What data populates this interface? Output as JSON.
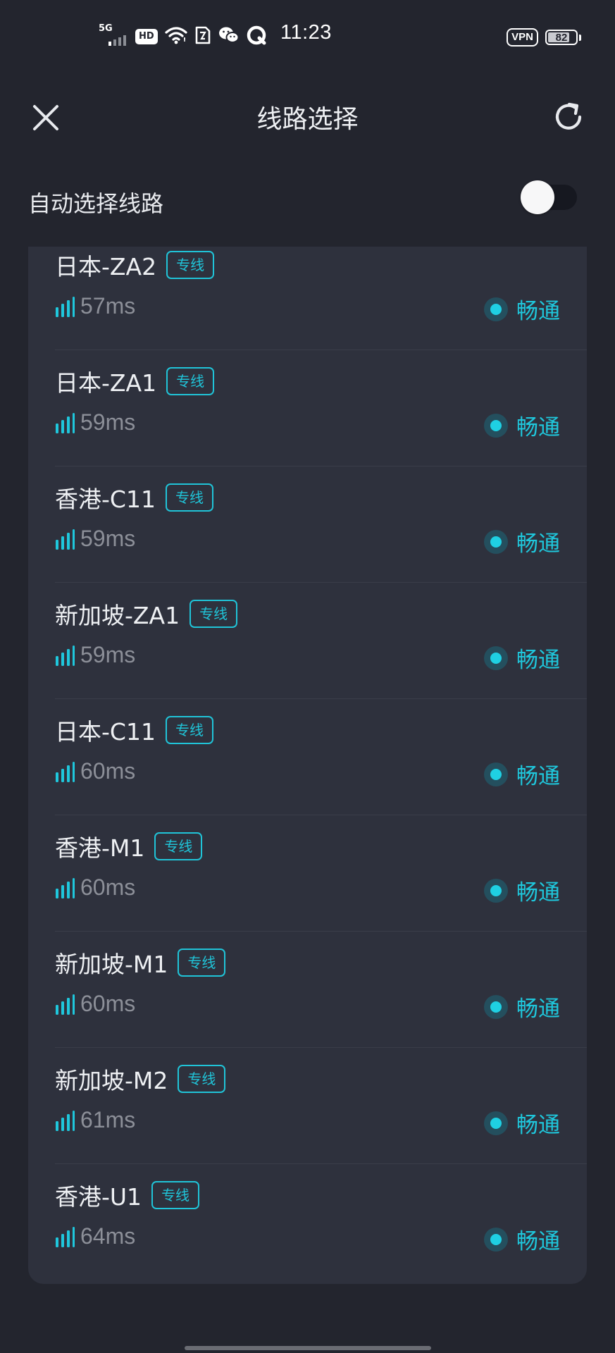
{
  "status_bar": {
    "network": "5G",
    "hd": "HD",
    "time": "11:23",
    "vpn": "VPN",
    "battery": "82",
    "battery_level": 0.82
  },
  "header": {
    "title": "线路选择"
  },
  "auto_select": {
    "label": "自动选择线路",
    "enabled": false
  },
  "colors": {
    "accent": "#1fc7dc",
    "background": "#23252e",
    "card": "#2e313d"
  },
  "servers": [
    {
      "name": "日本-ZA2",
      "tag": "专线",
      "latency": "57ms",
      "status": "畅通"
    },
    {
      "name": "日本-ZA1",
      "tag": "专线",
      "latency": "59ms",
      "status": "畅通"
    },
    {
      "name": "香港-C11",
      "tag": "专线",
      "latency": "59ms",
      "status": "畅通"
    },
    {
      "name": "新加坡-ZA1",
      "tag": "专线",
      "latency": "59ms",
      "status": "畅通"
    },
    {
      "name": "日本-C11",
      "tag": "专线",
      "latency": "60ms",
      "status": "畅通"
    },
    {
      "name": "香港-M1",
      "tag": "专线",
      "latency": "60ms",
      "status": "畅通"
    },
    {
      "name": "新加坡-M1",
      "tag": "专线",
      "latency": "60ms",
      "status": "畅通"
    },
    {
      "name": "新加坡-M2",
      "tag": "专线",
      "latency": "61ms",
      "status": "畅通"
    },
    {
      "name": "香港-U1",
      "tag": "专线",
      "latency": "64ms",
      "status": "畅通"
    }
  ]
}
